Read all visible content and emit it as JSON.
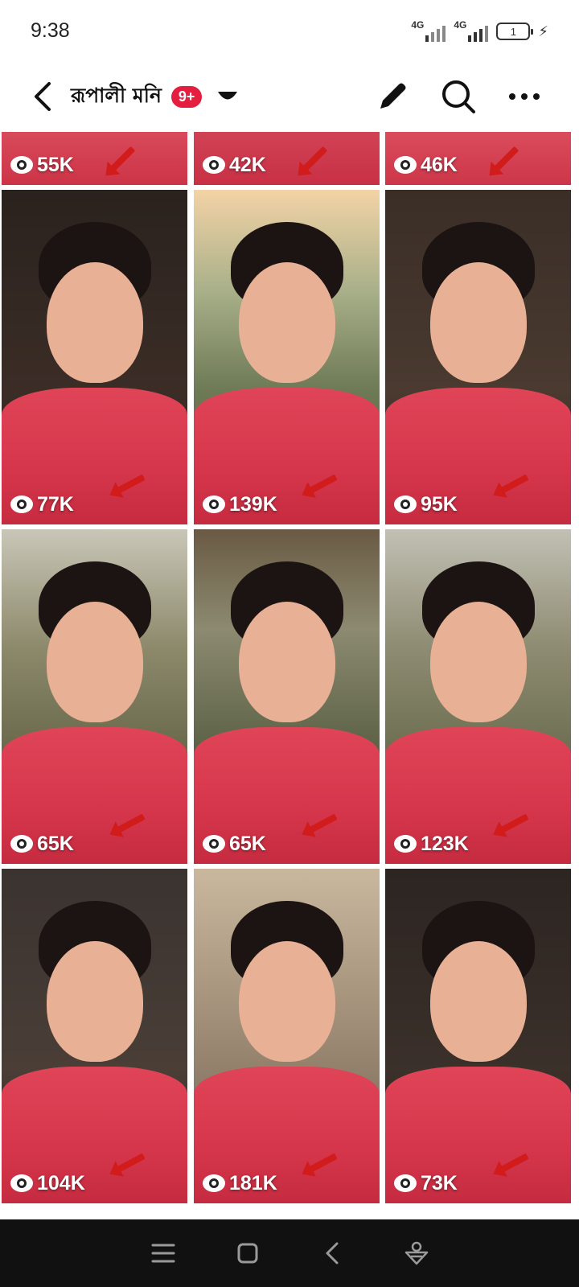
{
  "status_bar": {
    "time": "9:38",
    "network1": "4G",
    "network2": "4G",
    "battery": "1"
  },
  "header": {
    "title": "রূপালী মনি",
    "badge": "9+",
    "icons": [
      "back-arrow-icon",
      "caret-down-icon",
      "pencil-icon",
      "search-icon",
      "more-horizontal-icon"
    ]
  },
  "grid": {
    "rows": [
      {
        "partial": true,
        "items": [
          {
            "views": "55K"
          },
          {
            "views": "42K"
          },
          {
            "views": "46K"
          }
        ]
      },
      {
        "partial": false,
        "items": [
          {
            "views": "77K"
          },
          {
            "views": "139K"
          },
          {
            "views": "95K"
          }
        ]
      },
      {
        "partial": false,
        "items": [
          {
            "views": "65K"
          },
          {
            "views": "65K"
          },
          {
            "views": "123K"
          }
        ]
      },
      {
        "partial": false,
        "items": [
          {
            "views": "104K"
          },
          {
            "views": "181K"
          },
          {
            "views": "73K"
          }
        ]
      }
    ]
  },
  "colors": {
    "accent": "#e41e3f",
    "dupatta": "#d6364b",
    "nav_bg": "#111111"
  },
  "navbar": {
    "icons": [
      "menu-icon",
      "home-square-icon",
      "back-icon",
      "assistant-icon"
    ]
  }
}
